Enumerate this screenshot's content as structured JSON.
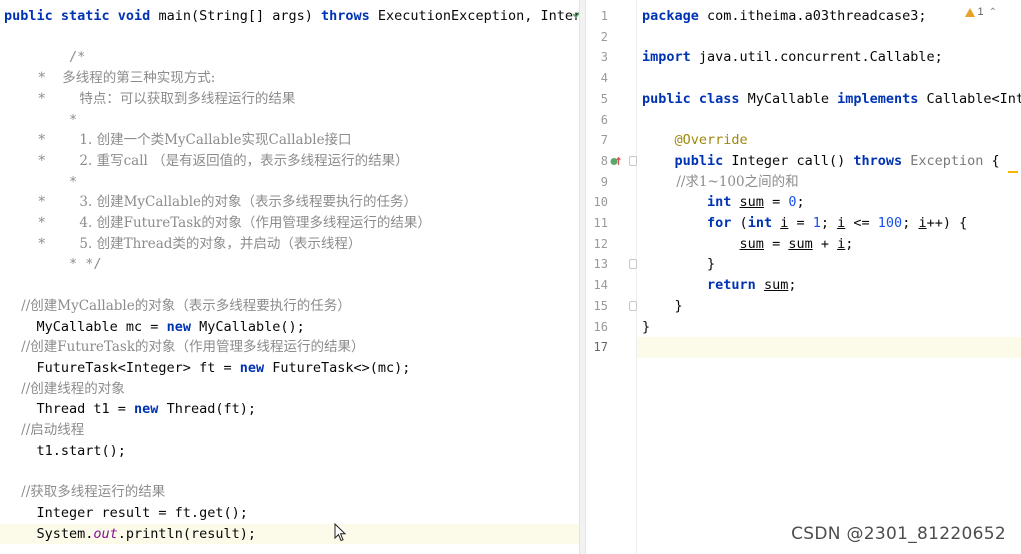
{
  "left_editor": {
    "lines": [
      [
        {
          "t": "public static void ",
          "c": "kw"
        },
        {
          "t": "main(String[] args) ",
          "c": ""
        },
        {
          "t": "throws ",
          "c": "kw"
        },
        {
          "t": "ExecutionException, Interr",
          "c": ""
        }
      ],
      [],
      [
        {
          "t": "        /*",
          "c": "cm"
        }
      ],
      [
        {
          "t": "        *    多线程的第三种实现方式:",
          "c": "cm-doc"
        }
      ],
      [
        {
          "t": "        *        特点：可以获取到多线程运行的结果",
          "c": "cm-doc"
        }
      ],
      [
        {
          "t": "        *",
          "c": "cm"
        }
      ],
      [
        {
          "t": "        *        1. 创建一个类MyCallable实现Callable接口",
          "c": "cm-doc"
        }
      ],
      [
        {
          "t": "        *        2. 重写call （是有返回值的，表示多线程运行的结果）",
          "c": "cm-doc"
        }
      ],
      [
        {
          "t": "        *",
          "c": "cm"
        }
      ],
      [
        {
          "t": "        *        3. 创建MyCallable的对象（表示多线程要执行的任务）",
          "c": "cm-doc"
        }
      ],
      [
        {
          "t": "        *        4. 创建FutureTask的对象（作用管理多线程运行的结果）",
          "c": "cm-doc"
        }
      ],
      [
        {
          "t": "        *        5. 创建Thread类的对象，并启动（表示线程）",
          "c": "cm-doc"
        }
      ],
      [
        {
          "t": "        * */",
          "c": "cm"
        }
      ],
      [],
      [
        {
          "t": "    //创建MyCallable的对象（表示多线程要执行的任务）",
          "c": "cm-doc"
        }
      ],
      [
        {
          "t": "    MyCallable mc = ",
          "c": ""
        },
        {
          "t": "new ",
          "c": "kw"
        },
        {
          "t": "MyCallable();",
          "c": ""
        }
      ],
      [
        {
          "t": "    //创建FutureTask的对象（作用管理多线程运行的结果）",
          "c": "cm-doc"
        }
      ],
      [
        {
          "t": "    FutureTask<Integer> ft = ",
          "c": ""
        },
        {
          "t": "new ",
          "c": "kw"
        },
        {
          "t": "FutureTask<>(mc);",
          "c": ""
        }
      ],
      [
        {
          "t": "    //创建线程的对象",
          "c": "cm-doc"
        }
      ],
      [
        {
          "t": "    Thread t1 = ",
          "c": ""
        },
        {
          "t": "new ",
          "c": "kw"
        },
        {
          "t": "Thread(ft);",
          "c": ""
        }
      ],
      [
        {
          "t": "    //启动线程",
          "c": "cm-doc"
        }
      ],
      [
        {
          "t": "    t1.start();",
          "c": ""
        }
      ],
      [],
      [
        {
          "t": "    //获取多线程运行的结果",
          "c": "cm-doc"
        }
      ],
      [
        {
          "t": "    Integer result = ft.get();",
          "c": ""
        }
      ],
      [
        {
          "t": "    System.",
          "c": ""
        },
        {
          "t": "out",
          "c": "it"
        },
        {
          "t": ".println(result);",
          "c": ""
        }
      ]
    ],
    "current_line_index": 25
  },
  "right_editor": {
    "line_numbers": [
      "1",
      "2",
      "3",
      "4",
      "5",
      "6",
      "7",
      "8",
      "9",
      "10",
      "11",
      "12",
      "13",
      "14",
      "15",
      "16",
      "17"
    ],
    "lines": [
      [
        {
          "t": "package ",
          "c": "kw"
        },
        {
          "t": "com.itheima.a03threadcase3;",
          "c": ""
        }
      ],
      [],
      [
        {
          "t": "import ",
          "c": "kw"
        },
        {
          "t": "java.util.concurrent.Callable;",
          "c": ""
        }
      ],
      [],
      [
        {
          "t": "public class ",
          "c": "kw"
        },
        {
          "t": "MyCallable ",
          "c": ""
        },
        {
          "t": "implements ",
          "c": "kw"
        },
        {
          "t": "Callable<Inte",
          "c": ""
        }
      ],
      [],
      [
        {
          "t": "    ",
          "c": ""
        },
        {
          "t": "@Override",
          "c": "an"
        }
      ],
      [
        {
          "t": "    ",
          "c": ""
        },
        {
          "t": "public ",
          "c": "kw"
        },
        {
          "t": "Integer call() ",
          "c": ""
        },
        {
          "t": "throws ",
          "c": "kw"
        },
        {
          "t": "Exception",
          "c": "gray"
        },
        {
          "t": " {",
          "c": ""
        }
      ],
      [
        {
          "t": "        //求1~100之间的和",
          "c": "cm-doc"
        }
      ],
      [
        {
          "t": "        ",
          "c": ""
        },
        {
          "t": "int ",
          "c": "kw"
        },
        {
          "t": "sum",
          "c": "ul"
        },
        {
          "t": " = ",
          "c": ""
        },
        {
          "t": "0",
          "c": "num"
        },
        {
          "t": ";",
          "c": ""
        }
      ],
      [
        {
          "t": "        ",
          "c": ""
        },
        {
          "t": "for ",
          "c": "kw"
        },
        {
          "t": "(",
          "c": ""
        },
        {
          "t": "int ",
          "c": "kw"
        },
        {
          "t": "i",
          "c": "ul"
        },
        {
          "t": " = ",
          "c": ""
        },
        {
          "t": "1",
          "c": "num"
        },
        {
          "t": "; ",
          "c": ""
        },
        {
          "t": "i",
          "c": "ul"
        },
        {
          "t": " <= ",
          "c": ""
        },
        {
          "t": "100",
          "c": "num"
        },
        {
          "t": "; ",
          "c": ""
        },
        {
          "t": "i",
          "c": "ul"
        },
        {
          "t": "++) {",
          "c": ""
        }
      ],
      [
        {
          "t": "            ",
          "c": ""
        },
        {
          "t": "sum",
          "c": "ul"
        },
        {
          "t": " = ",
          "c": ""
        },
        {
          "t": "sum",
          "c": "ul"
        },
        {
          "t": " + ",
          "c": ""
        },
        {
          "t": "i",
          "c": "ul"
        },
        {
          "t": ";",
          "c": ""
        }
      ],
      [
        {
          "t": "        }",
          "c": ""
        }
      ],
      [
        {
          "t": "        ",
          "c": ""
        },
        {
          "t": "return ",
          "c": "kw"
        },
        {
          "t": "sum",
          "c": "ul"
        },
        {
          "t": ";",
          "c": ""
        }
      ],
      [
        {
          "t": "    }",
          "c": ""
        }
      ],
      [
        {
          "t": "}",
          "c": ""
        }
      ],
      []
    ],
    "current_line_index": 16,
    "fold_lines": [
      7,
      12,
      14
    ],
    "warning_badge": {
      "icon": "warning-triangle-icon",
      "count": "1"
    }
  },
  "watermark": "CSDN @2301_81220652",
  "colors": {
    "keyword": "#0033b3",
    "comment": "#8c8c8c",
    "annotation": "#9e880d",
    "number": "#1750eb",
    "current_line": "#fcfae9"
  }
}
